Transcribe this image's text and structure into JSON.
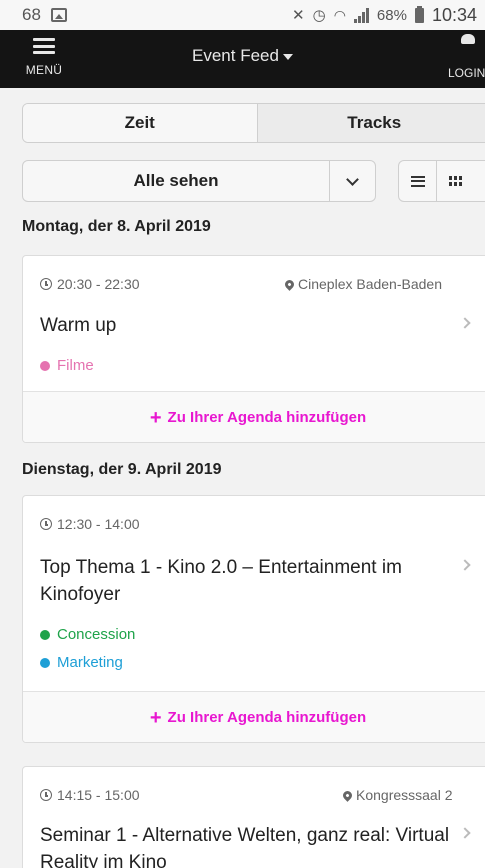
{
  "status_bar": {
    "notification_count": "68",
    "battery": "68%",
    "time": "10:34"
  },
  "header": {
    "menu_label": "MENÜ",
    "title": "Event Feed",
    "login_label": "LOGIN"
  },
  "tabs": [
    {
      "label": "Zeit",
      "active": true
    },
    {
      "label": "Tracks",
      "active": false
    }
  ],
  "filter": {
    "selected": "Alle sehen"
  },
  "colors": {
    "accent": "#e817d0",
    "filme": "#e573b0",
    "concession": "#1fa34a",
    "marketing": "#1e9fd6"
  },
  "days": [
    {
      "label": "Montag, der 8. April 2019",
      "events": [
        {
          "time": "20:30 - 22:30",
          "location": "Cineplex Baden-Baden",
          "title": "Warm up",
          "tags": [
            {
              "label": "Filme",
              "color": "#e573b0"
            }
          ],
          "add_label": "Zu Ihrer Agenda hinzufügen"
        }
      ]
    },
    {
      "label": "Dienstag, der 9. April 2019",
      "events": [
        {
          "time": "12:30 - 14:00",
          "location": "",
          "title": "Top Thema 1 - Kino 2.0 – Entertainment im Kinofoyer",
          "tags": [
            {
              "label": "Concession",
              "color": "#1fa34a"
            },
            {
              "label": "Marketing",
              "color": "#1e9fd6"
            }
          ],
          "add_label": "Zu Ihrer Agenda hinzufügen"
        },
        {
          "time": "14:15 - 15:00",
          "location": "Kongresssaal 2",
          "title": "Seminar 1 - Alternative Welten, ganz real: Virtual Reality im Kino",
          "tags": [],
          "add_label": ""
        }
      ]
    }
  ]
}
